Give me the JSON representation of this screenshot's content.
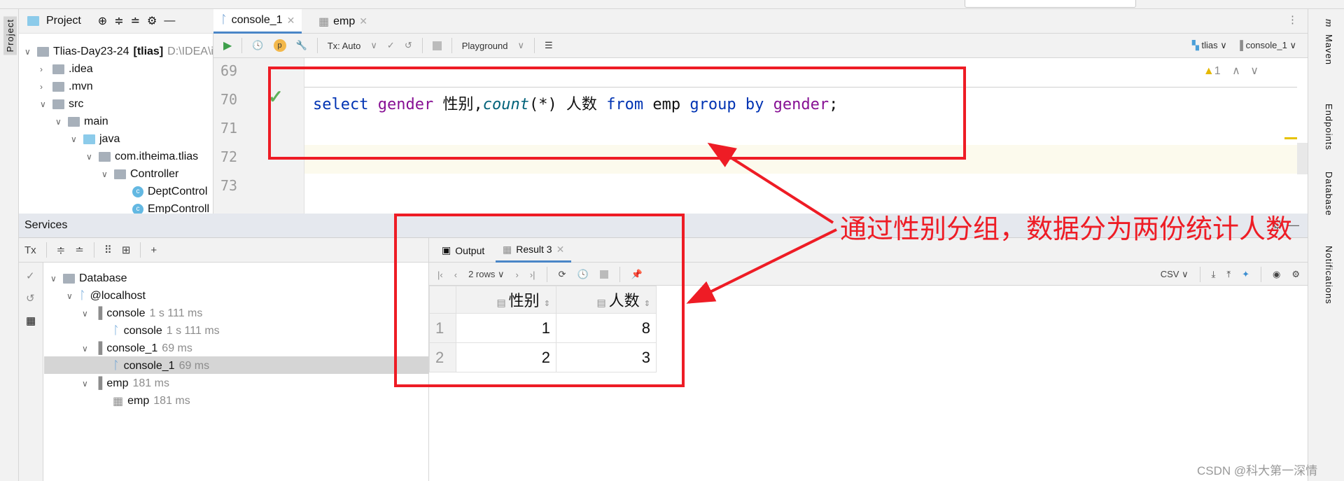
{
  "left_stripe": {
    "project_label": "Project"
  },
  "project_panel": {
    "title": "Project",
    "tree": [
      {
        "label": "Tlias-Day23-24",
        "bold": "[tlias]",
        "path": "D:\\IDEA\\i"
      },
      {
        "label": ".idea"
      },
      {
        "label": ".mvn"
      },
      {
        "label": "src"
      },
      {
        "label": "main"
      },
      {
        "label": "java"
      },
      {
        "label": "com.itheima.tlias"
      },
      {
        "label": "Controller"
      },
      {
        "label": "DeptControl"
      },
      {
        "label": "EmpControll"
      }
    ]
  },
  "editor": {
    "tabs": [
      {
        "label": "console_1"
      },
      {
        "label": "emp"
      }
    ],
    "toolbar": {
      "tx": "Tx: Auto",
      "playground": "Playground",
      "schema": "tlias",
      "session": "console_1"
    },
    "warnings": "1",
    "line_numbers": [
      "69",
      "70",
      "71",
      "72",
      "73"
    ],
    "code": {
      "t1": "select",
      "t2": "gender",
      "t3": "性别,",
      "t4": "count",
      "t5": "(*) 人数 ",
      "t6": "from",
      "t7": " emp ",
      "t8": "group by",
      "t9": "gender",
      ";": ";"
    }
  },
  "services": {
    "title": "Services",
    "tx": "Tx",
    "tree": [
      {
        "label": "Database",
        "time": ""
      },
      {
        "label": "@localhost",
        "time": ""
      },
      {
        "label": "console",
        "time": "1 s 111 ms"
      },
      {
        "label": "console",
        "time": "1 s 111 ms"
      },
      {
        "label": "console_1",
        "time": "69 ms"
      },
      {
        "label": "console_1",
        "time": "69 ms"
      },
      {
        "label": "emp",
        "time": "181 ms"
      },
      {
        "label": "emp",
        "time": "181 ms"
      }
    ]
  },
  "results": {
    "tabs": [
      {
        "label": "Output"
      },
      {
        "label": "Result 3"
      }
    ],
    "rows_label": "2 rows",
    "export": "CSV",
    "columns": [
      "性别",
      "人数"
    ],
    "rows": [
      [
        "1",
        "1",
        "8"
      ],
      [
        "2",
        "2",
        "3"
      ]
    ]
  },
  "right_stripe": [
    "Maven",
    "Endpoints",
    "Database",
    "Notifications"
  ],
  "annotation": {
    "text": "通过性别分组，数据分为两份统计人数",
    "color": "#ee1c25"
  },
  "watermark": "CSDN @科大第一深情"
}
